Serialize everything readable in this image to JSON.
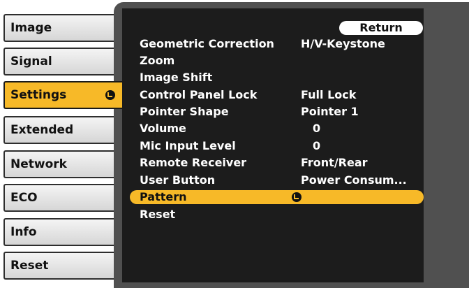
{
  "sidebar": {
    "tabs": [
      {
        "label": "Image"
      },
      {
        "label": "Signal"
      },
      {
        "label": "Settings"
      },
      {
        "label": "Extended"
      },
      {
        "label": "Network"
      },
      {
        "label": "ECO"
      },
      {
        "label": "Info"
      },
      {
        "label": "Reset"
      }
    ],
    "active": "Settings"
  },
  "menu": {
    "return_label": "Return",
    "items": [
      {
        "name": "Geometric Correction",
        "value": "H/V-Keystone"
      },
      {
        "name": "Zoom",
        "value": ""
      },
      {
        "name": "Image Shift",
        "value": ""
      },
      {
        "name": "Control Panel Lock",
        "value": "Full Lock"
      },
      {
        "name": "Pointer Shape",
        "value": "Pointer 1"
      },
      {
        "name": "Volume",
        "value": "0"
      },
      {
        "name": "Mic Input Level",
        "value": "0"
      },
      {
        "name": "Remote Receiver",
        "value": "Front/Rear"
      },
      {
        "name": "User Button",
        "value": "Power Consum..."
      },
      {
        "name": "Pattern",
        "value": ""
      },
      {
        "name": "Reset",
        "value": ""
      }
    ],
    "selected": "Pattern"
  },
  "colors": {
    "accent": "#f7b928",
    "panel": "#505050",
    "inner": "#1c1c1c"
  },
  "icons": {
    "enter": "enter-icon"
  }
}
